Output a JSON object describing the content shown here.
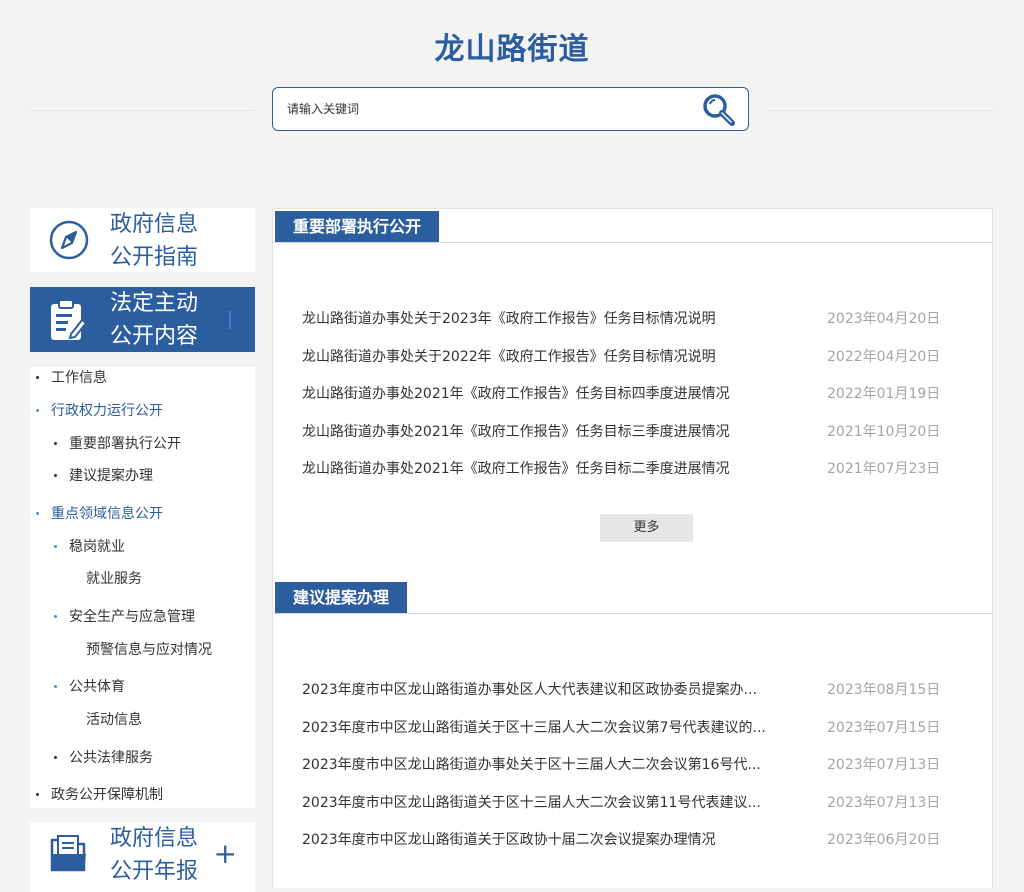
{
  "site": {
    "title": "龙山路街道"
  },
  "search": {
    "placeholder": "请输入关键词"
  },
  "sidebar": {
    "guide": {
      "line1": "政府信息",
      "line2": "公开指南"
    },
    "active": {
      "line1": "法定主动",
      "line2": "公开内容"
    },
    "annual": {
      "line1": "政府信息",
      "line2": "公开年报"
    },
    "nav": {
      "work_info": "工作信息",
      "power_run": "行政权力运行公开",
      "dept_exec": "重要部署执行公开",
      "suggest": "建议提案办理",
      "key_area": "重点领域信息公开",
      "employment": "稳岗就业",
      "employment_service": "就业服务",
      "safety": "安全生产与应急管理",
      "warning": "预警信息与应对情况",
      "sports": "公共体育",
      "activity": "活动信息",
      "legal": "公共法律服务",
      "guarantee": "政务公开保障机制"
    }
  },
  "sections": [
    {
      "title": "重要部署执行公开",
      "more_label": "更多",
      "items": [
        {
          "title": "龙山路街道办事处关于2023年《政府工作报告》任务目标情况说明",
          "date": "2023年04月20日"
        },
        {
          "title": "龙山路街道办事处关于2022年《政府工作报告》任务目标情况说明",
          "date": "2022年04月20日"
        },
        {
          "title": "龙山路街道办事处2021年《政府工作报告》任务目标四季度进展情况",
          "date": "2022年01月19日"
        },
        {
          "title": "龙山路街道办事处2021年《政府工作报告》任务目标三季度进展情况",
          "date": "2021年10月20日"
        },
        {
          "title": "龙山路街道办事处2021年《政府工作报告》任务目标二季度进展情况",
          "date": "2021年07月23日"
        }
      ]
    },
    {
      "title": "建议提案办理",
      "items": [
        {
          "title": "2023年度市中区龙山路街道办事处区人大代表建议和区政协委员提案办...",
          "date": "2023年08月15日"
        },
        {
          "title": "2023年度市中区龙山路街道关于区十三届人大二次会议第7号代表建议的...",
          "date": "2023年07月15日"
        },
        {
          "title": "2023年度市中区龙山路街道办事处关于区十三届人大二次会议第16号代...",
          "date": "2023年07月13日"
        },
        {
          "title": "2023年度市中区龙山路街道关于区十三届人大二次会议第11号代表建议...",
          "date": "2023年07月13日"
        },
        {
          "title": "2023年度市中区龙山路街道关于区政协十届二次会议提案办理情况",
          "date": "2023年06月20日"
        }
      ]
    }
  ],
  "colors": {
    "brand": "#2c5d9e",
    "date": "#a5a5a5",
    "background": "#f3f3f3"
  }
}
